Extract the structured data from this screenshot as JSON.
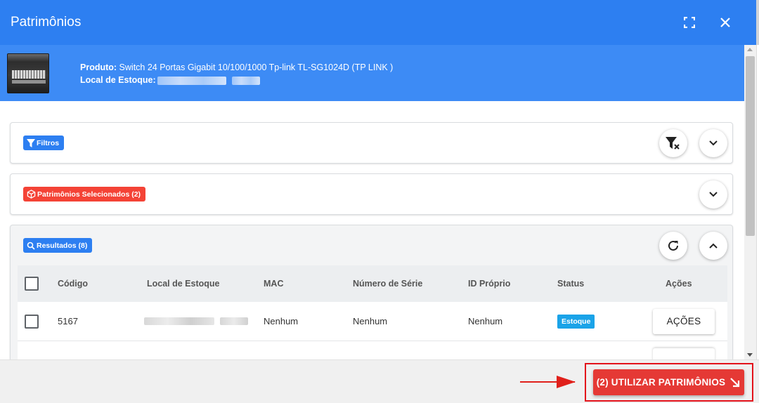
{
  "dialog": {
    "title": "Patrimônios",
    "expand_icon": "fullscreen-icon",
    "close_icon": "close-icon"
  },
  "product": {
    "produto_label": "Produto:",
    "produto_value": " Switch 24 Portas Gigabit 10/100/1000 Tp-link TL-SG1024D (TP LINK )",
    "local_label": "Local de Estoque:",
    "local_value_redacted": true
  },
  "panels": {
    "filters": {
      "label": "Filtros",
      "icon": "filter-icon",
      "clear_icon": "filter-clear-icon",
      "toggle_icon": "chevron-down-icon"
    },
    "selected": {
      "label": "Patrimônios Selecionados (2)",
      "icon": "box-icon",
      "toggle_icon": "chevron-down-icon",
      "color": "#f44336"
    },
    "results": {
      "label": "Resultados (8)",
      "icon": "search-icon",
      "refresh_icon": "refresh-icon",
      "toggle_icon": "chevron-up-icon"
    }
  },
  "table": {
    "columns": [
      "Código",
      "Local de Estoque",
      "MAC",
      "Número de Série",
      "ID Próprio",
      "Status",
      "Ações"
    ],
    "rows": [
      {
        "codigo": "5167",
        "local_redacted": true,
        "mac": "Nenhum",
        "serie": "Nenhum",
        "id_proprio": "Nenhum",
        "status": "Estoque",
        "acoes": "AÇÕES"
      }
    ]
  },
  "footer": {
    "use_button": "(2) UTILIZAR PATRIMÔNIOS",
    "use_icon": "arrow-down-right-icon"
  },
  "colors": {
    "header_blue": "#2d7ff1",
    "banner_blue": "#3d8bf5",
    "danger_red": "#e53935",
    "status_blue": "#1aa3e8"
  }
}
